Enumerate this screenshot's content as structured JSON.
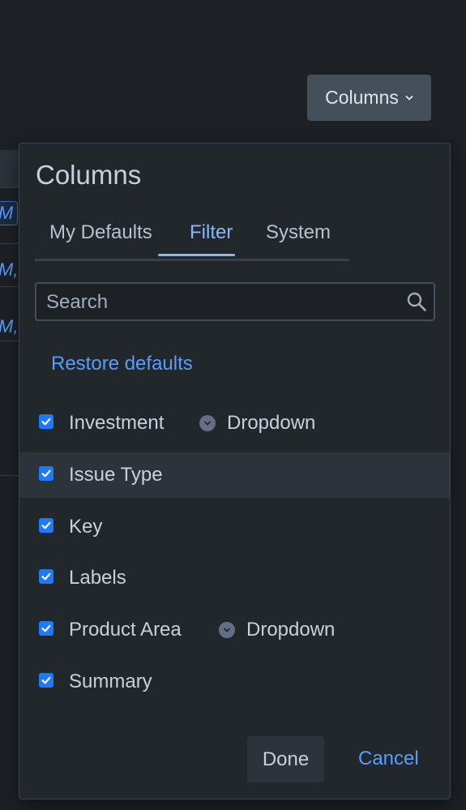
{
  "background": {
    "chip_text": "M",
    "row_fragments": [
      "M,",
      "M,"
    ]
  },
  "trigger": {
    "label": "Columns",
    "icon": "chevron-down-icon"
  },
  "panel": {
    "title": "Columns",
    "tabs": [
      {
        "label": "My Defaults",
        "active": false
      },
      {
        "label": "Filter",
        "active": true
      },
      {
        "label": "System",
        "active": false
      }
    ],
    "search": {
      "placeholder": "Search",
      "value": "",
      "icon": "search-icon"
    },
    "restore_label": "Restore defaults",
    "items": [
      {
        "label": "Investment",
        "checked": true,
        "tag": "Dropdown"
      },
      {
        "label": "Issue Type",
        "checked": true,
        "highlighted": true
      },
      {
        "label": "Key",
        "checked": true
      },
      {
        "label": "Labels",
        "checked": true
      },
      {
        "label": "Product Area",
        "checked": true,
        "tag": "Dropdown"
      },
      {
        "label": "Summary",
        "checked": true
      }
    ],
    "done_label": "Done",
    "cancel_label": "Cancel"
  },
  "colors": {
    "background": "#1d2125",
    "panel": "#22272b",
    "accent": "#579dff",
    "checkbox": "#1d7afc",
    "highlight_row": "#2c333a"
  }
}
